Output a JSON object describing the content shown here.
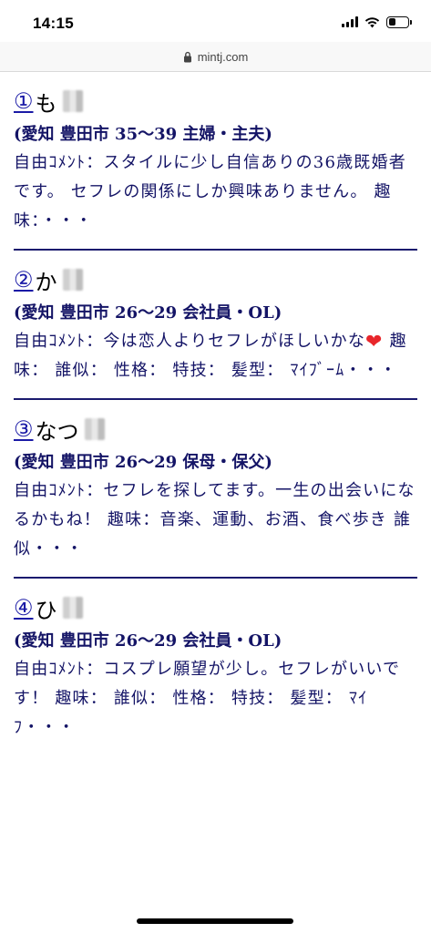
{
  "status_bar": {
    "time": "14:15",
    "battery_level": 0.45
  },
  "browser": {
    "url": "mintj.com",
    "lock_icon": "lock-icon"
  },
  "entries": [
    {
      "number": "①",
      "name": "も",
      "meta": "(愛知 豊田市 35〜39 主婦・主夫)",
      "comment_before": "自由ｺﾒﾝﾄ：スタイルに少し自信ありの36歳既婚者です。 セフレの関係にしか興味ありません。 趣味：・・・",
      "comment_after": ""
    },
    {
      "number": "②",
      "name": "か",
      "meta": "(愛知 豊田市 26〜29 会社員・OL)",
      "comment_before": "自由ｺﾒﾝﾄ：今は恋人よりセフレがほしいかな",
      "comment_after": " 趣味： 誰似： 性格： 特技： 髪型： ﾏｲﾌﾞｰﾑ・・・"
    },
    {
      "number": "③",
      "name": "なつ",
      "meta": "(愛知 豊田市 26〜29 保母・保父)",
      "comment_before": "自由ｺﾒﾝﾄ：セフレを探してます。一生の出会いになるかもね！ 趣味：音楽、運動、お酒、食べ歩き 誰似・・・",
      "comment_after": ""
    },
    {
      "number": "④",
      "name": "ひ",
      "meta": "(愛知 豊田市 26〜29 会社員・OL)",
      "comment_before": "自由ｺﾒﾝﾄ：コスプレ願望が少し。セフレがいいです！ 趣味： 誰似： 性格： 特技： 髪型： ﾏｲﾌ・・・",
      "comment_after": ""
    }
  ],
  "colors": {
    "text": "#141466",
    "link": "#1a1aa6",
    "separator": "#1a1a6e",
    "heart": "#e8262b"
  }
}
